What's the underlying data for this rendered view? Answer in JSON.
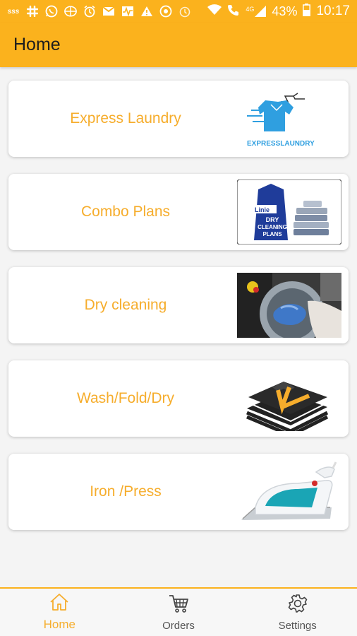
{
  "status_bar": {
    "battery": "43%",
    "time": "10:17",
    "network": "4G",
    "icons": [
      "sss-icon",
      "slack-icon",
      "whatsapp-icon",
      "vpn-icon",
      "alarm-icon",
      "gmail-icon",
      "activity-icon",
      "warning-icon",
      "circle-icon",
      "alarm-icon",
      "wifi-icon",
      "call-icon",
      "signal-icon",
      "battery-icon"
    ]
  },
  "app_bar": {
    "title": "Home"
  },
  "services": [
    {
      "label": "Express Laundry",
      "image": "express-laundry-image",
      "image_text": "EXPRESSLAUNDRY"
    },
    {
      "label": "Combo Plans",
      "image": "dry-cleaning-plans-image",
      "image_text": [
        "Linie",
        "DRY",
        "CLEANING",
        "PLANS"
      ]
    },
    {
      "label": "Dry cleaning",
      "image": "washing-machine-image"
    },
    {
      "label": "Wash/Fold/Dry",
      "image": "folded-shirts-image"
    },
    {
      "label": "Iron /Press",
      "image": "steam-iron-image"
    }
  ],
  "bottom_nav": [
    {
      "label": "Home",
      "icon": "home-icon",
      "active": true
    },
    {
      "label": "Orders",
      "icon": "cart-icon",
      "active": false
    },
    {
      "label": "Settings",
      "icon": "gear-icon",
      "active": false
    }
  ],
  "colors": {
    "primary": "#fbb21d",
    "accent_text": "#f6ad2c"
  }
}
